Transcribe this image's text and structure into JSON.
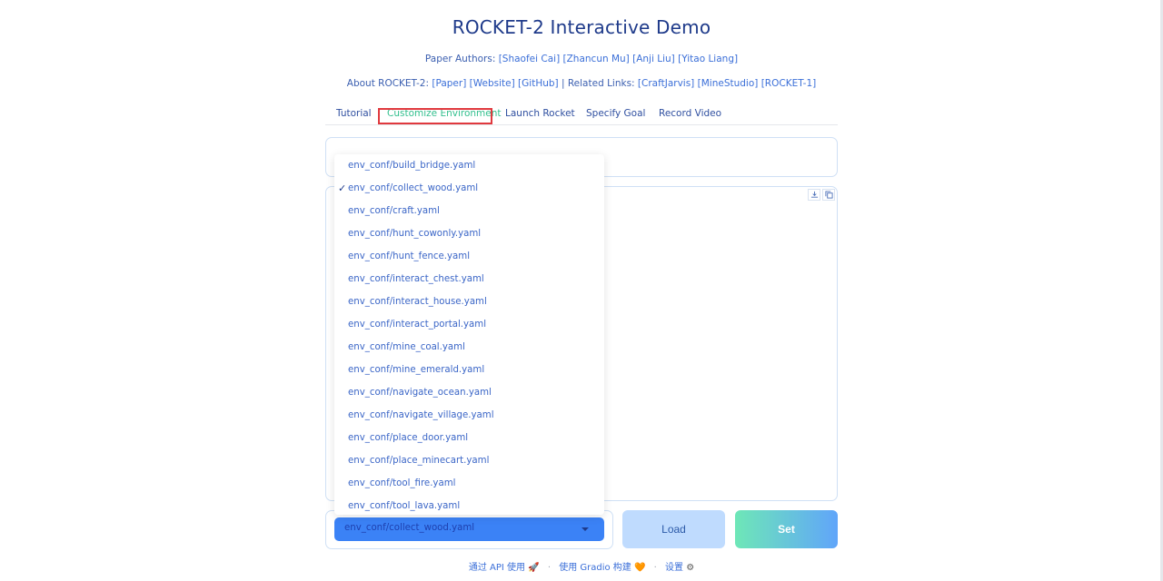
{
  "header": {
    "title": "ROCKET-2 Interactive Demo",
    "authors": {
      "prefix": "Paper Authors: ",
      "names": [
        "[Shaofei Cai]",
        "[Zhancun Mu]",
        "[Anji Liu]",
        "[Yitao Liang]"
      ]
    },
    "about": {
      "prefix": "About ROCKET-2: ",
      "links": [
        "[Paper]",
        "[Website]",
        "[GitHub]"
      ],
      "divider": " | Related Links: ",
      "related": [
        "[CraftJarvis]",
        "[MineStudio]",
        "[ROCKET-1]"
      ]
    }
  },
  "tabs": [
    "Tutorial",
    "Customize Environment",
    "Launch Rocket",
    "Specify Goal",
    "Record Video"
  ],
  "selected_tab": "Customize Environment",
  "dropdown": {
    "options": [
      "env_conf/build_bridge.yaml",
      "env_conf/collect_wood.yaml",
      "env_conf/craft.yaml",
      "env_conf/hunt_cowonly.yaml",
      "env_conf/hunt_fence.yaml",
      "env_conf/interact_chest.yaml",
      "env_conf/interact_house.yaml",
      "env_conf/interact_portal.yaml",
      "env_conf/mine_coal.yaml",
      "env_conf/mine_emerald.yaml",
      "env_conf/navigate_ocean.yaml",
      "env_conf/navigate_village.yaml",
      "env_conf/place_door.yaml",
      "env_conf/place_minecart.yaml",
      "env_conf/tool_fire.yaml",
      "env_conf/tool_lava.yaml"
    ],
    "selected_value": "env_conf/collect_wood.yaml",
    "check_mark": "✓"
  },
  "buttons": {
    "load": "Load",
    "set": "Set"
  },
  "footer": {
    "api": "通过 API 使用",
    "api_icon": "🚀",
    "gradio": "使用 Gradio 构建",
    "gradio_icon": "🧡",
    "settings": "设置",
    "settings_icon": "⚙",
    "separator": "·"
  },
  "colors": {
    "selected_tab": "#34c08f",
    "highlight_box": "#e0393e",
    "select_bg": "#3b82f6"
  }
}
